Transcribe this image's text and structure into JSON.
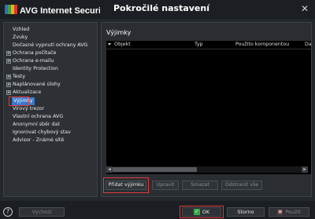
{
  "window": {
    "title": "AVG Internet Security",
    "subtitle": "Pokročilé nastavení"
  },
  "sidebar": {
    "items": [
      {
        "label": "Vzhled",
        "expandable": false
      },
      {
        "label": "Zvuky",
        "expandable": false
      },
      {
        "label": "Dočasné vypnutí ochrany AVG",
        "expandable": false
      },
      {
        "label": "Ochrana počítače",
        "expandable": true
      },
      {
        "label": "Ochrana e-mailu",
        "expandable": true
      },
      {
        "label": "Identity Protection",
        "expandable": false
      },
      {
        "label": "Testy",
        "expandable": true
      },
      {
        "label": "Naplánované úlohy",
        "expandable": true
      },
      {
        "label": "Aktualizace",
        "expandable": true
      },
      {
        "label": "Výjimky",
        "expandable": false,
        "selected": true
      },
      {
        "label": "Virový trezor",
        "expandable": false
      },
      {
        "label": "Vlastní ochrana AVG",
        "expandable": false
      },
      {
        "label": "Anonymní sběr dat",
        "expandable": false
      },
      {
        "label": "Ignorovat chybový stav",
        "expandable": false
      },
      {
        "label": "Advisor - Známé sítě",
        "expandable": false
      }
    ]
  },
  "main": {
    "section_title": "Výjimky",
    "table": {
      "columns": [
        "Objekt",
        "Typ",
        "Použito komponentou",
        "Da"
      ],
      "rows": []
    },
    "buttons": {
      "add": "Přidat výjimku",
      "edit": "Upravit",
      "delete": "Smazat",
      "delete_all": "Odstranit vše"
    }
  },
  "footer": {
    "help": "?",
    "defaults": "Výchozí",
    "ok": "OK",
    "cancel": "Storno",
    "apply": "Použít"
  },
  "colors": {
    "selection": "#3a78c9",
    "highlight_frame": "#e23a3a",
    "ok_icon": "#3aa84b"
  }
}
